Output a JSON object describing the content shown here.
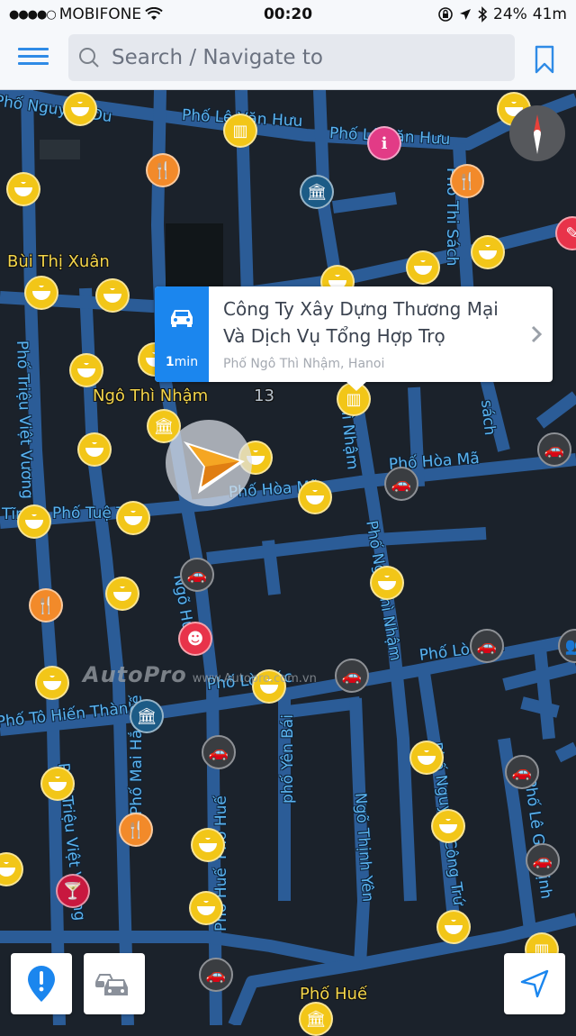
{
  "status_bar": {
    "signal_dots": "●●●●○",
    "carrier": "MOBIFONE",
    "wifi_icon": "wifi-icon",
    "time": "00:20",
    "battery": "24%",
    "battery_time": "41m",
    "icons": [
      "orientation-lock-icon",
      "location-arrow-icon",
      "bluetooth-icon"
    ]
  },
  "top_bar": {
    "menu_icon": "hamburger-menu-icon",
    "search_placeholder": "Search / Navigate to",
    "search_value": "",
    "bookmark_icon": "bookmark-icon",
    "accent_color": "#2f8be6"
  },
  "place_card": {
    "eta_value": "1",
    "eta_unit": "min",
    "mode_icon": "car-icon",
    "title": "Công Ty Xây Dựng Thương Mại Và Dịch Vụ Tổng Hợp Trọ",
    "title_line1": "Công Ty Xây Dựng Thương Mại",
    "title_line2": "Và Dịch Vụ Tổng Hợp Trọ",
    "address": "Phố Ngô Thì Nhậm, Hanoi",
    "accent_color": "#1b86ee"
  },
  "map": {
    "area_labels": [
      {
        "text": "Bùi Thị Xuân"
      },
      {
        "text": "Ngô Thì Nhậm"
      },
      {
        "text": "13"
      },
      {
        "text": "Phố Huế"
      }
    ],
    "street_labels": [
      {
        "text": "Phố Nguyễn Du"
      },
      {
        "text": "Phố Lê Văn Hưu"
      },
      {
        "text": "Phố Lê Văn Hưu"
      },
      {
        "text": "Phố Thi Sách"
      },
      {
        "text": "Phố Triệu Việt Vương"
      },
      {
        "text": "Tĩnh"
      },
      {
        "text": "Phố Tuệ Tĩnh"
      },
      {
        "text": "Ngõ Huế"
      },
      {
        "text": "Phố Hòa Mã"
      },
      {
        "text": "Phố Hòa Mã"
      },
      {
        "text": "Thì Nhậm"
      },
      {
        "text": "Phố Ngô Thì Nhậm"
      },
      {
        "text": "Phố Lò Đúc"
      },
      {
        "text": "Phố Lò Đúc"
      },
      {
        "text": "Phố Tô Hiến Thành"
      },
      {
        "text": "phố Yên Bái"
      },
      {
        "text": "Ngõ Thịnh Yên"
      },
      {
        "text": "Phố Nguyễn Công Trứ"
      },
      {
        "text": "Phố Lê Gia Định"
      },
      {
        "text": "Phố Triệu Việt Vương"
      },
      {
        "text": "Phố Mai Hắc Đế"
      },
      {
        "text": "Phố Huế"
      },
      {
        "text": "Phố Huế"
      },
      {
        "text": "sách"
      }
    ],
    "compass_icon": "compass-icon",
    "watermark": {
      "logo": "AutoPro",
      "url": "www.Autopro.com.vn"
    }
  },
  "bottom_controls": {
    "report_icon": "report-alert-pin-icon",
    "traffic_icon": "traffic-cars-icon",
    "locate_icon": "navigation-arrow-icon"
  }
}
